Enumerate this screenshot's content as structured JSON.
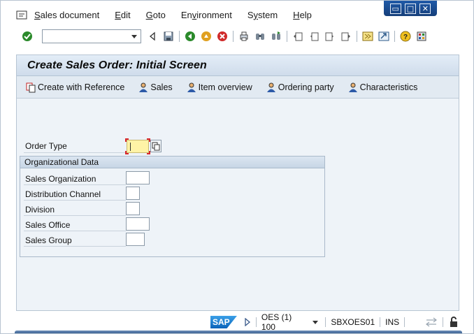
{
  "window": {
    "controls": [
      {
        "name": "minimize",
        "glyph": "▭"
      },
      {
        "name": "maximize",
        "glyph": "□"
      },
      {
        "name": "close",
        "glyph": "✕"
      }
    ]
  },
  "menubar": {
    "items": [
      {
        "underline": "S",
        "rest": "ales document"
      },
      {
        "underline": "E",
        "rest": "dit"
      },
      {
        "underline": "G",
        "rest": "oto"
      },
      {
        "underline": "",
        "pre": "En",
        "rest": "v",
        "post": "ironment"
      },
      {
        "underline": "",
        "pre": "S",
        "rest": "y",
        "post": "stem"
      },
      {
        "underline": "H",
        "rest": "elp"
      }
    ]
  },
  "toolbar": {
    "command_field_value": "",
    "icons": [
      "enter-icon",
      "back-nav-icon",
      "save-icon",
      "back-icon",
      "exit-icon",
      "cancel-icon",
      "print-icon",
      "find-icon",
      "find-next-icon",
      "first-page-icon",
      "previous-page-icon",
      "next-page-icon",
      "last-page-icon",
      "create-session-icon",
      "shortcut-icon",
      "help-icon",
      "layout-icon"
    ]
  },
  "screen": {
    "title": "Create Sales Order: Initial Screen",
    "app_buttons": [
      {
        "label": "Create with Reference",
        "icon": "copy-reference-icon"
      },
      {
        "label": "Sales",
        "icon": "sales-person-icon"
      },
      {
        "label": "Item overview",
        "icon": "item-overview-icon"
      },
      {
        "label": "Ordering party",
        "icon": "ordering-party-icon"
      },
      {
        "label": "Characteristics",
        "icon": "characteristics-icon"
      }
    ]
  },
  "form": {
    "order_type_label": "Order Type",
    "order_type_value": "",
    "org_group_title": "Organizational Data",
    "fields": [
      {
        "label": "Sales Organization",
        "value": ""
      },
      {
        "label": "Distribution Channel",
        "value": ""
      },
      {
        "label": "Division",
        "value": ""
      },
      {
        "label": "Sales Office",
        "value": ""
      },
      {
        "label": "Sales Group",
        "value": ""
      }
    ]
  },
  "statusbar": {
    "logo_text": "SAP",
    "system": "OES (1) 100",
    "server": "SBXOES01",
    "mode": "INS"
  },
  "colors": {
    "accent_blue": "#1f5aa8",
    "required_field": "#fff3a6",
    "required_corner": "#d8262c",
    "panel_bg": "#eef3f8"
  }
}
